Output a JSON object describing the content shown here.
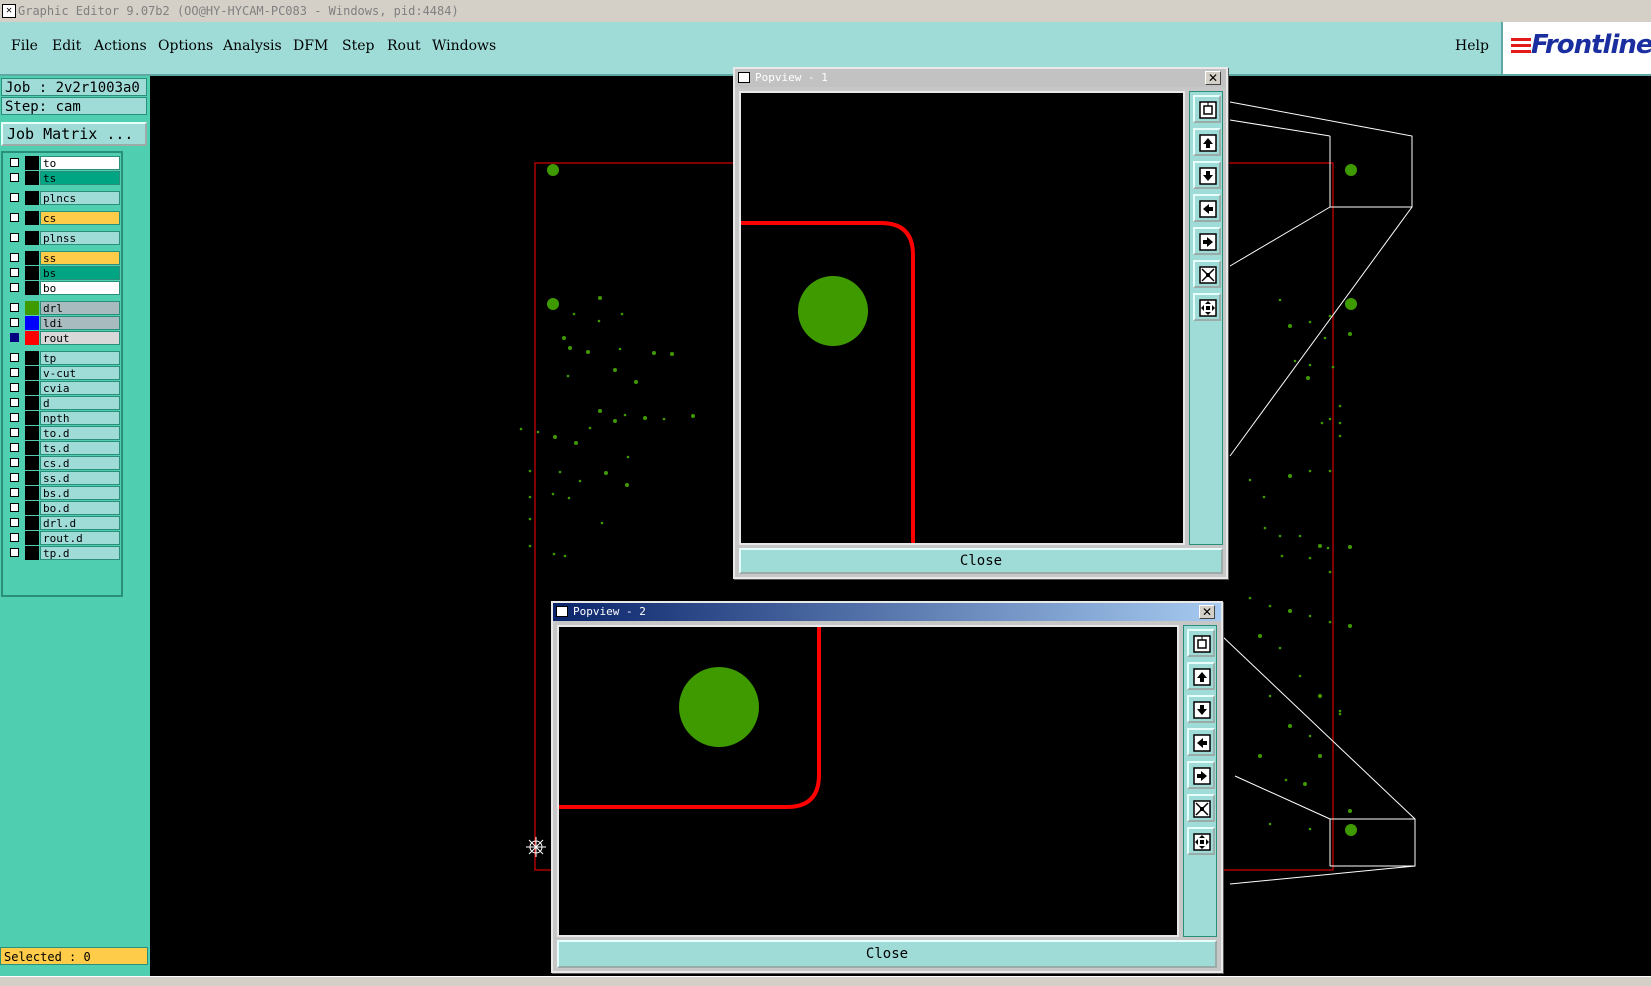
{
  "window": {
    "title": "Graphic Editor 9.07b2 (OO@HY-HYCAM-PC083 - Windows, pid:4484)"
  },
  "menu": {
    "items": [
      "File",
      "Edit",
      "Actions",
      "Options",
      "Analysis",
      "DFM",
      "Step",
      "Rout",
      "Windows"
    ],
    "help": "Help"
  },
  "logo": {
    "text": "Frontline"
  },
  "job": {
    "job_line": "Job : 2v2r1003a0",
    "step_line": "Step: cam",
    "matrix_button": "Job Matrix ..."
  },
  "layers": [
    {
      "name": "to",
      "bg": "#ffffff",
      "swatch": "#000000",
      "checked": false
    },
    {
      "name": "ts",
      "bg": "#00a583",
      "swatch": "#000000",
      "checked": false
    },
    {
      "name": "plncs",
      "bg": "#9fdcd8",
      "swatch": "#000000",
      "checked": false
    },
    {
      "name": "cs",
      "bg": "#ffcc4a",
      "swatch": "#000000",
      "checked": false
    },
    {
      "name": "plnss",
      "bg": "#9fdcd8",
      "swatch": "#000000",
      "checked": false
    },
    {
      "name": "ss",
      "bg": "#ffcc4a",
      "swatch": "#000000",
      "checked": false
    },
    {
      "name": "bs",
      "bg": "#00a583",
      "swatch": "#000000",
      "checked": false
    },
    {
      "name": "bo",
      "bg": "#ffffff",
      "swatch": "#000000",
      "checked": false
    },
    {
      "name": "drl",
      "bg": "#a8bcc0",
      "swatch": "#3f9a00",
      "checked": false
    },
    {
      "name": "ldi",
      "bg": "#a8bcc0",
      "swatch": "#0000ff",
      "checked": false
    },
    {
      "name": "rout",
      "bg": "#d8d8d8",
      "swatch": "#ff0000",
      "checked": true
    },
    {
      "name": "tp",
      "bg": "#9fdcd8",
      "swatch": "#000000",
      "checked": false
    },
    {
      "name": "v-cut",
      "bg": "#9fdcd8",
      "swatch": "#000000",
      "checked": false
    },
    {
      "name": "cvia",
      "bg": "#9fdcd8",
      "swatch": "#000000",
      "checked": false
    },
    {
      "name": "d",
      "bg": "#9fdcd8",
      "swatch": "#000000",
      "checked": false
    },
    {
      "name": "npth",
      "bg": "#9fdcd8",
      "swatch": "#000000",
      "checked": false
    },
    {
      "name": "to.d",
      "bg": "#9fdcd8",
      "swatch": "#000000",
      "checked": false
    },
    {
      "name": "ts.d",
      "bg": "#9fdcd8",
      "swatch": "#000000",
      "checked": false
    },
    {
      "name": "cs.d",
      "bg": "#9fdcd8",
      "swatch": "#000000",
      "checked": false
    },
    {
      "name": "ss.d",
      "bg": "#9fdcd8",
      "swatch": "#000000",
      "checked": false
    },
    {
      "name": "bs.d",
      "bg": "#9fdcd8",
      "swatch": "#000000",
      "checked": false
    },
    {
      "name": "bo.d",
      "bg": "#9fdcd8",
      "swatch": "#000000",
      "checked": false
    },
    {
      "name": "drl.d",
      "bg": "#9fdcd8",
      "swatch": "#000000",
      "checked": false
    },
    {
      "name": "rout.d",
      "bg": "#9fdcd8",
      "swatch": "#000000",
      "checked": false
    },
    {
      "name": "tp.d",
      "bg": "#9fdcd8",
      "swatch": "#000000",
      "checked": false
    }
  ],
  "status": {
    "selected": "Selected : 0"
  },
  "popups": [
    {
      "title": "Popview - 1",
      "close_label": "Close",
      "active": false,
      "tools": [
        "fit-view-icon",
        "pan-up-icon",
        "pan-down-icon",
        "pan-left-icon",
        "pan-right-icon",
        "zoom-out-icon",
        "zoom-in-icon"
      ]
    },
    {
      "title": "Popview - 2",
      "close_label": "Close",
      "active": true,
      "tools": [
        "fit-view-icon",
        "pan-up-icon",
        "pan-down-icon",
        "pan-left-icon",
        "pan-right-icon",
        "zoom-out-icon",
        "zoom-in-icon"
      ]
    }
  ],
  "colors": {
    "rout": "#ff0000",
    "drill": "#3f9a00",
    "menu_bg": "#9fdcd8",
    "panel_bg": "#4fcfb0"
  }
}
